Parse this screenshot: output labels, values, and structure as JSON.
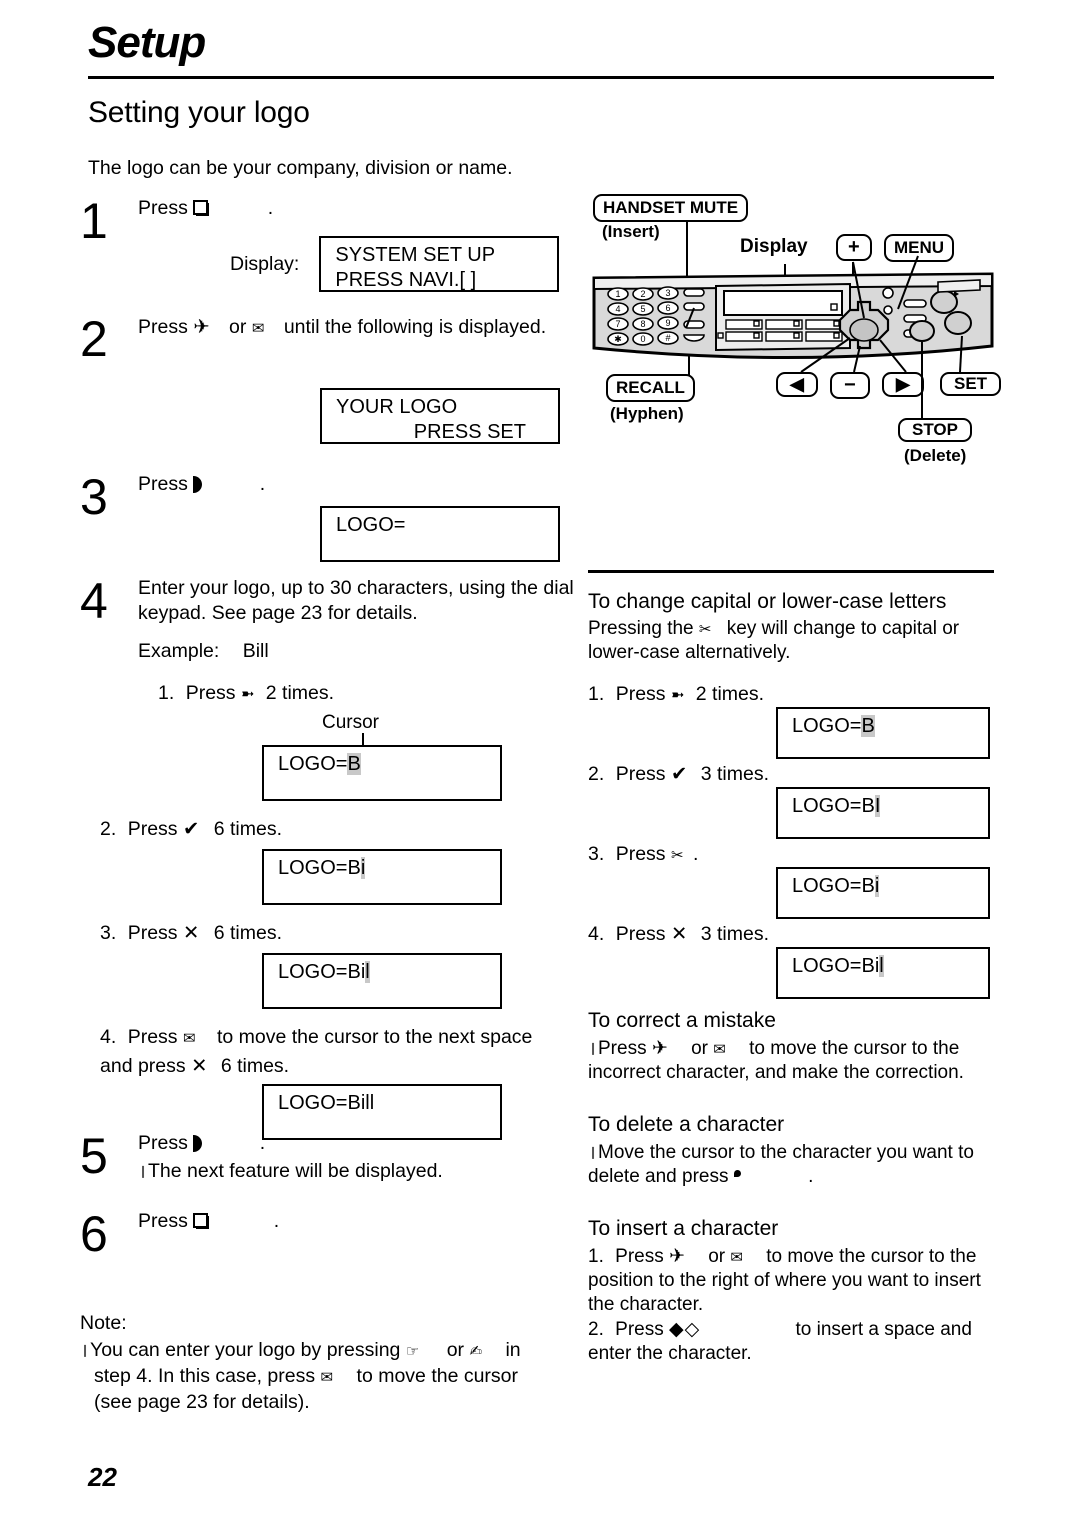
{
  "header": {
    "chapter": "Setup",
    "section_title": "Setting your logo",
    "intro": "The logo can be your company, division or name."
  },
  "page_number": "22",
  "left_steps": [
    {
      "num": "1",
      "text_before": "Press",
      "icon": "menu-button-icon",
      "text_after": ".",
      "display_label": "Display:",
      "lcd_line1": "SYSTEM SET UP",
      "lcd_line2": "PRESS NAVI.[        ]"
    },
    {
      "num": "2",
      "text_before": "Press",
      "icon1": "airplane-icon",
      "text_mid": "or",
      "icon2": "envelope-icon",
      "text_after": "until the following is displayed.",
      "lcd_line1": "YOUR LOGO",
      "lcd_line2": "PRESS SET"
    },
    {
      "num": "3",
      "text_before": "Press",
      "icon": "set-button-icon",
      "text_after": ".",
      "lcd_line1": "LOGO="
    },
    {
      "num": "4",
      "text": "Enter your logo, up to 30 characters, using the dial keypad. See page 23 for details.",
      "example_label": "Example:",
      "example_value": "Bill",
      "cursor_label": "Cursor",
      "substeps": [
        {
          "n": "1.",
          "before": "Press",
          "icon": "dial-key-2-icon",
          "after": "2 times.",
          "lcd_pre": "LOGO=",
          "lcd_cursor": "B",
          "lcd_post": ""
        },
        {
          "n": "2.",
          "before": "Press",
          "icon": "dial-key-4-icon",
          "after": "6 times.",
          "lcd_pre": "LOGO=B",
          "lcd_cursor": "i",
          "lcd_post": ""
        },
        {
          "n": "3.",
          "before": "Press",
          "icon": "dial-key-5-icon",
          "after": "6 times.",
          "lcd_pre": "LOGO=Bi",
          "lcd_cursor": "l",
          "lcd_post": ""
        },
        {
          "n": "4.",
          "before": "Press",
          "icon": "envelope-icon",
          "after": "to move the cursor to the next space and press",
          "icon2": "dial-key-5-icon",
          "after2": "6 times.",
          "lcd_pre": "LOGO=Bill",
          "lcd_cursor": " ",
          "lcd_post": ""
        }
      ]
    },
    {
      "num": "5",
      "text_before": "Press",
      "icon": "set-button-icon",
      "text_after": ".",
      "note": "The next feature will be displayed."
    },
    {
      "num": "6",
      "text_before": "Press",
      "icon": "menu-button-icon",
      "text_after": "."
    }
  ],
  "note": {
    "label": "Note:",
    "line1_a": "You can enter your logo by pressing",
    "icon1": "pointing-hand-icon",
    "line1_b": "or",
    "icon2": "writing-hand-icon",
    "line1_c": "in",
    "line2_a": "step 4. In this case, press",
    "icon3": "envelope-icon",
    "line2_b": "to move the cursor",
    "line3": "(see page 23 for details)."
  },
  "diagram": {
    "callouts": {
      "handset_mute": "HANDSET MUTE",
      "insert": "(Insert)",
      "display": "Display",
      "plus": "+",
      "menu": "MENU",
      "recall": "RECALL",
      "hyphen": "(Hyphen)",
      "left_arrow": "◀",
      "minus": "−",
      "right_arrow": "▶",
      "set": "SET",
      "stop": "STOP",
      "delete": "(Delete)"
    },
    "keypad": [
      "1",
      "2",
      "3",
      "4",
      "5",
      "6",
      "7",
      "8",
      "9",
      "✱",
      "0",
      "#"
    ]
  },
  "right_sections": [
    {
      "heading": "To change capital or lower-case letters",
      "para_a": "Pressing the",
      "icon": "scissors-icon",
      "para_b": "key will change to capital or lower-case alternatively.",
      "substeps": [
        {
          "n": "1.",
          "before": "Press",
          "icon": "dial-key-2-icon",
          "after": "2 times.",
          "lcd_pre": "LOGO=",
          "lcd_cursor": "B",
          "lcd_post": ""
        },
        {
          "n": "2.",
          "before": "Press",
          "icon": "dial-key-4-icon",
          "after": "3 times.",
          "lcd_pre": "LOGO=B",
          "lcd_cursor": "I",
          "lcd_post": ""
        },
        {
          "n": "3.",
          "before": "Press",
          "icon": "scissors-icon",
          "after": ".",
          "lcd_pre": "LOGO=B",
          "lcd_cursor": "i",
          "lcd_post": ""
        },
        {
          "n": "4.",
          "before": "Press",
          "icon": "dial-key-5-icon",
          "after": "3 times.",
          "lcd_pre": "LOGO=Bi",
          "lcd_cursor": "l",
          "lcd_post": ""
        }
      ]
    },
    {
      "heading": "To correct a mistake",
      "line_a": "Press",
      "icon1": "airplane-icon",
      "line_b": "or",
      "icon2": "envelope-icon",
      "line_c": "to move the cursor to the incorrect character, and make the correction."
    },
    {
      "heading": "To delete a character",
      "line_a": "Move the cursor to the character you want to delete and press",
      "icon1": "stop-button-icon",
      "line_b": "."
    },
    {
      "heading": "To insert a character",
      "s1_n": "1.",
      "s1_a": "Press",
      "s1_icon1": "airplane-icon",
      "s1_b": "or",
      "s1_icon2": "envelope-icon",
      "s1_c": "to move the cursor to the position to the right of where you want to insert the character.",
      "s2_n": "2.",
      "s2_a": "Press",
      "s2_icon": "handset-mute-icon",
      "s2_b": "to insert a space and enter the character."
    }
  ]
}
